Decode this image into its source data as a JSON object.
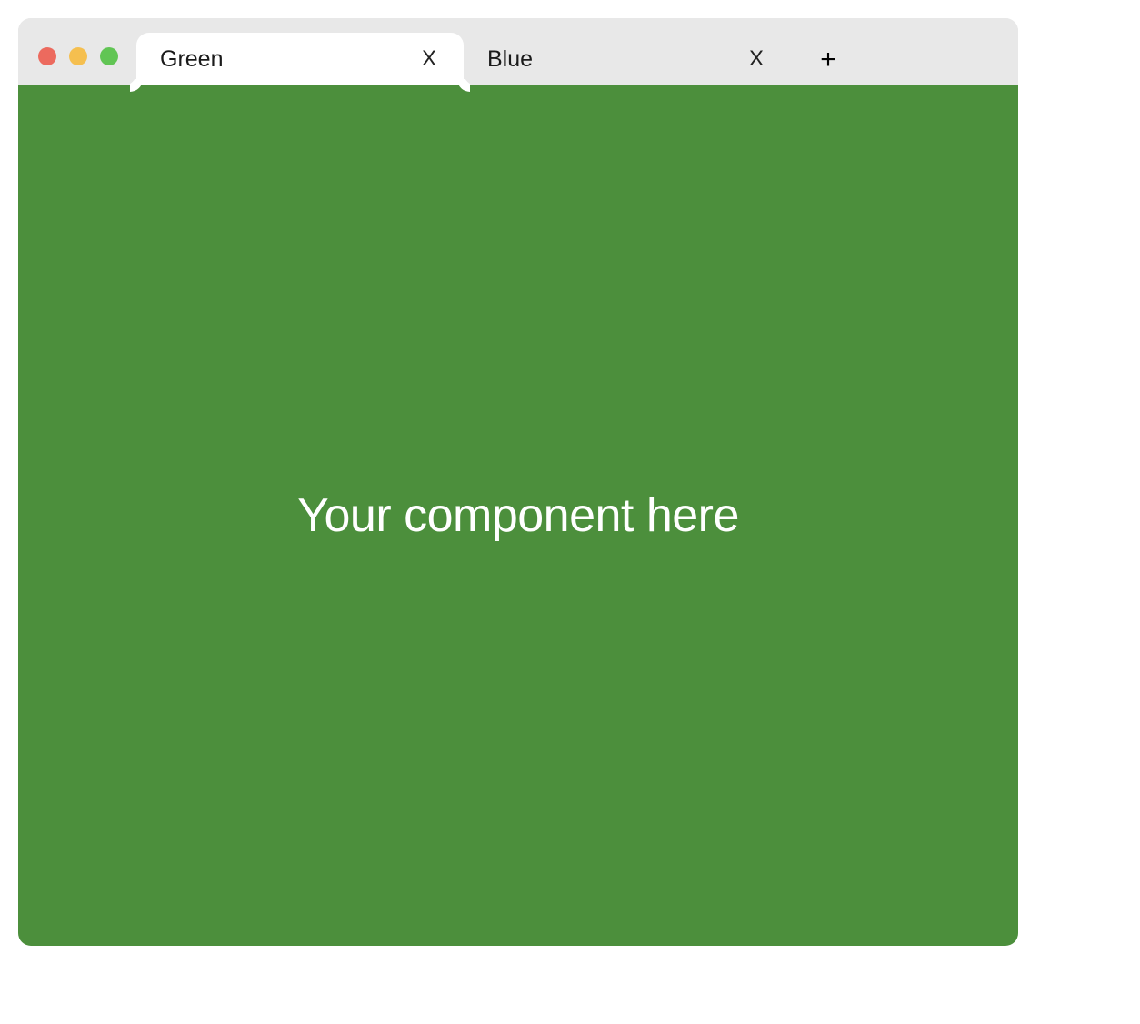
{
  "colors": {
    "content_background": "#4c8f3c",
    "tab_bar_background": "#e8e8e8",
    "active_tab_background": "#ffffff",
    "traffic_close": "#ec6a5e",
    "traffic_min": "#f5bf4f",
    "traffic_max": "#61c554"
  },
  "tabs": [
    {
      "label": "Green",
      "close_label": "X",
      "active": true
    },
    {
      "label": "Blue",
      "close_label": "X",
      "active": false
    }
  ],
  "new_tab_label": "+",
  "content": {
    "placeholder_text": "Your component here"
  }
}
